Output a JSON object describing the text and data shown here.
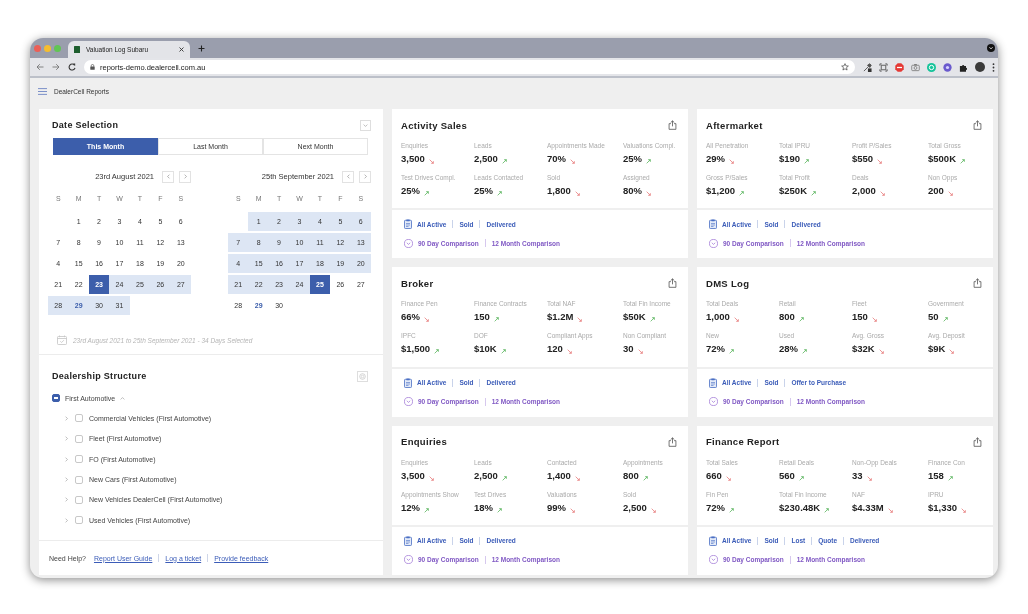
{
  "browser": {
    "tab_title": "Valuation Log Subaru",
    "url": "reports-demo.dealercell.com.au"
  },
  "app_header": {
    "title": "DealerCell Reports"
  },
  "date_selection": {
    "title": "Date Selection",
    "presets": [
      {
        "label": "This Month",
        "selected": true
      },
      {
        "label": "Last Month",
        "selected": false
      },
      {
        "label": "Next Month",
        "selected": false
      }
    ],
    "calendars": [
      {
        "heading": "23rd August 2021",
        "weekdays": [
          "S",
          "M",
          "T",
          "W",
          "T",
          "F",
          "S"
        ],
        "weeks": [
          [
            {
              "day": "1",
              "selected": false,
              "in_range": false,
              "today": false
            },
            {
              "day": "2",
              "selected": false,
              "in_range": false,
              "today": false
            },
            {
              "day": "3",
              "selected": false,
              "in_range": false,
              "today": false
            },
            {
              "day": "4",
              "selected": false,
              "in_range": false,
              "today": false
            },
            {
              "day": "5",
              "selected": false,
              "in_range": false,
              "today": false
            },
            {
              "day": "6",
              "selected": false,
              "in_range": false,
              "today": false
            }
          ],
          [
            {
              "day": "7",
              "selected": false,
              "in_range": false,
              "today": false
            },
            {
              "day": "8",
              "selected": false,
              "in_range": false,
              "today": false
            },
            {
              "day": "9",
              "selected": false,
              "in_range": false,
              "today": false
            },
            {
              "day": "10",
              "selected": false,
              "in_range": false,
              "today": false
            },
            {
              "day": "11",
              "selected": false,
              "in_range": false,
              "today": false
            },
            {
              "day": "12",
              "selected": false,
              "in_range": false,
              "today": false
            },
            {
              "day": "13",
              "selected": false,
              "in_range": false,
              "today": false
            }
          ],
          [
            {
              "day": "4",
              "selected": false,
              "in_range": false,
              "today": false
            },
            {
              "day": "15",
              "selected": false,
              "in_range": false,
              "today": false
            },
            {
              "day": "16",
              "selected": false,
              "in_range": false,
              "today": false
            },
            {
              "day": "17",
              "selected": false,
              "in_range": false,
              "today": false
            },
            {
              "day": "18",
              "selected": false,
              "in_range": false,
              "today": false
            },
            {
              "day": "19",
              "selected": false,
              "in_range": false,
              "today": false
            },
            {
              "day": "20",
              "selected": false,
              "in_range": false,
              "today": false
            }
          ],
          [
            {
              "day": "21",
              "selected": false,
              "in_range": false,
              "today": false
            },
            {
              "day": "22",
              "selected": false,
              "in_range": false,
              "today": false
            },
            {
              "day": "23",
              "selected": true,
              "in_range": true,
              "today": false
            },
            {
              "day": "24",
              "selected": false,
              "in_range": true,
              "today": false
            },
            {
              "day": "25",
              "selected": false,
              "in_range": true,
              "today": false
            },
            {
              "day": "26",
              "selected": false,
              "in_range": true,
              "today": false
            },
            {
              "day": "27",
              "selected": false,
              "in_range": true,
              "today": false
            }
          ],
          [
            {
              "day": "28",
              "selected": false,
              "in_range": true,
              "today": false
            },
            {
              "day": "29",
              "selected": false,
              "in_range": true,
              "today": true
            },
            {
              "day": "30",
              "selected": false,
              "in_range": true,
              "today": false
            },
            {
              "day": "31",
              "selected": false,
              "in_range": true,
              "today": false
            }
          ]
        ]
      },
      {
        "heading": "25th September 2021",
        "weekdays": [
          "S",
          "M",
          "T",
          "W",
          "T",
          "F",
          "S"
        ],
        "weeks": [
          [
            {
              "day": "1",
              "selected": false,
              "in_range": true,
              "today": false
            },
            {
              "day": "2",
              "selected": false,
              "in_range": true,
              "today": false
            },
            {
              "day": "3",
              "selected": false,
              "in_range": true,
              "today": false
            },
            {
              "day": "4",
              "selected": false,
              "in_range": true,
              "today": false
            },
            {
              "day": "5",
              "selected": false,
              "in_range": true,
              "today": false
            },
            {
              "day": "6",
              "selected": false,
              "in_range": true,
              "today": false
            }
          ],
          [
            {
              "day": "7",
              "selected": false,
              "in_range": true,
              "today": false
            },
            {
              "day": "8",
              "selected": false,
              "in_range": true,
              "today": false
            },
            {
              "day": "9",
              "selected": false,
              "in_range": true,
              "today": false
            },
            {
              "day": "10",
              "selected": false,
              "in_range": true,
              "today": false
            },
            {
              "day": "11",
              "selected": false,
              "in_range": true,
              "today": false
            },
            {
              "day": "12",
              "selected": false,
              "in_range": true,
              "today": false
            },
            {
              "day": "13",
              "selected": false,
              "in_range": true,
              "today": false
            }
          ],
          [
            {
              "day": "4",
              "selected": false,
              "in_range": true,
              "today": false
            },
            {
              "day": "15",
              "selected": false,
              "in_range": true,
              "today": false
            },
            {
              "day": "16",
              "selected": false,
              "in_range": true,
              "today": false
            },
            {
              "day": "17",
              "selected": false,
              "in_range": true,
              "today": false
            },
            {
              "day": "18",
              "selected": false,
              "in_range": true,
              "today": false
            },
            {
              "day": "19",
              "selected": false,
              "in_range": true,
              "today": false
            },
            {
              "day": "20",
              "selected": false,
              "in_range": true,
              "today": false
            }
          ],
          [
            {
              "day": "21",
              "selected": false,
              "in_range": true,
              "today": false
            },
            {
              "day": "22",
              "selected": false,
              "in_range": true,
              "today": false
            },
            {
              "day": "23",
              "selected": false,
              "in_range": true,
              "today": false
            },
            {
              "day": "24",
              "selected": false,
              "in_range": true,
              "today": false
            },
            {
              "day": "25",
              "selected": true,
              "in_range": true,
              "today": false
            },
            {
              "day": "26",
              "selected": false,
              "in_range": false,
              "today": false
            },
            {
              "day": "27",
              "selected": false,
              "in_range": false,
              "today": false
            }
          ],
          [
            {
              "day": "28",
              "selected": false,
              "in_range": false,
              "today": false
            },
            {
              "day": "29",
              "selected": false,
              "in_range": false,
              "today": true
            },
            {
              "day": "30",
              "selected": false,
              "in_range": false,
              "today": false
            }
          ]
        ]
      }
    ],
    "range_text": "23rd August 2021 to 25th September 2021 - 34 Days Selected"
  },
  "dealership": {
    "title": "Dealership Structure",
    "tree": [
      {
        "label": "First Automotive",
        "checked": false,
        "indeterminate": true,
        "expanded": true,
        "children": [
          {
            "label": "Commercial Vehicles (First Automotive)",
            "checked": false,
            "indeterminate": false,
            "expanded": false
          },
          {
            "label": "Fleet (First Automotive)",
            "checked": false,
            "indeterminate": false,
            "expanded": false
          },
          {
            "label": "FO (First Automotive)",
            "checked": false,
            "indeterminate": false,
            "expanded": false
          },
          {
            "label": "New Cars (First Automotive)",
            "checked": false,
            "indeterminate": false,
            "expanded": false
          },
          {
            "label": "New Vehicles DealerCell (First Automotive)",
            "checked": false,
            "indeterminate": false,
            "expanded": false
          },
          {
            "label": "Used Vehicles (First Automotive)",
            "checked": false,
            "indeterminate": false,
            "expanded": false
          }
        ]
      }
    ]
  },
  "help": {
    "prompt": "Need Help?",
    "links": [
      "Report User Guide",
      "Log a ticket",
      "Provide feedback"
    ]
  },
  "cards": [
    {
      "title": "Activity Sales",
      "metrics": [
        {
          "label": "Enquiries",
          "value": "3,500",
          "rising": false
        },
        {
          "label": "Leads",
          "value": "2,500",
          "rising": true
        },
        {
          "label": "Appointments Made",
          "value": "70%",
          "rising": false
        },
        {
          "label": "Valuations Compl.",
          "value": "25%",
          "rising": true
        },
        {
          "label": "Test Drives Compl.",
          "value": "25%",
          "rising": true
        },
        {
          "label": "Leads Contacted",
          "value": "25%",
          "rising": true
        },
        {
          "label": "Sold",
          "value": "1,800",
          "rising": false
        },
        {
          "label": "Assigned",
          "value": "80%",
          "rising": false
        }
      ],
      "filters": [
        "All Active",
        "Sold",
        "Delivered"
      ],
      "comparisons": [
        "90 Day Comparison",
        "12 Month Comparison"
      ]
    },
    {
      "title": "Aftermarket",
      "metrics": [
        {
          "label": "All Penetration",
          "value": "29%",
          "rising": false
        },
        {
          "label": "Total IPRU",
          "value": "$190",
          "rising": true
        },
        {
          "label": "Profit P/Sales",
          "value": "$550",
          "rising": false
        },
        {
          "label": "Total Gross",
          "value": "$500K",
          "rising": true
        },
        {
          "label": "Gross P/Sales",
          "value": "$1,200",
          "rising": true
        },
        {
          "label": "Total Profit",
          "value": "$250K",
          "rising": true
        },
        {
          "label": "Deals",
          "value": "2,000",
          "rising": false
        },
        {
          "label": "Non Opps",
          "value": "200",
          "rising": false
        }
      ],
      "filters": [
        "All Active",
        "Sold",
        "Delivered"
      ],
      "comparisons": [
        "90 Day Comparison",
        "12 Month Comparison"
      ]
    },
    {
      "title": "Broker",
      "metrics": [
        {
          "label": "Finance Pen",
          "value": "66%",
          "rising": false
        },
        {
          "label": "Finance Contracts",
          "value": "150",
          "rising": true
        },
        {
          "label": "Total NAF",
          "value": "$1.2M",
          "rising": false
        },
        {
          "label": "Total Fin Income",
          "value": "$50K",
          "rising": true
        },
        {
          "label": "IPFC",
          "value": "$1,500",
          "rising": true
        },
        {
          "label": "DOF",
          "value": "$10K",
          "rising": true
        },
        {
          "label": "Compliant Apps",
          "value": "120",
          "rising": false
        },
        {
          "label": "Non Compliant",
          "value": "30",
          "rising": false
        }
      ],
      "filters": [
        "All Active",
        "Sold",
        "Delivered"
      ],
      "comparisons": [
        "90 Day Comparison",
        "12 Month Comparison"
      ]
    },
    {
      "title": "DMS Log",
      "metrics": [
        {
          "label": "Total Deals",
          "value": "1,000",
          "rising": false
        },
        {
          "label": "Retail",
          "value": "800",
          "rising": true
        },
        {
          "label": "Fleet",
          "value": "150",
          "rising": false
        },
        {
          "label": "Government",
          "value": "50",
          "rising": true
        },
        {
          "label": "New",
          "value": "72%",
          "rising": true
        },
        {
          "label": "Used",
          "value": "28%",
          "rising": true
        },
        {
          "label": "Avg. Gross",
          "value": "$32K",
          "rising": false
        },
        {
          "label": "Avg. Deposit",
          "value": "$9K",
          "rising": false
        }
      ],
      "filters": [
        "All Active",
        "Sold",
        "Offer to Purchase"
      ],
      "comparisons": [
        "90 Day Comparison",
        "12 Month Comparison"
      ]
    },
    {
      "title": "Enquiries",
      "metrics": [
        {
          "label": "Enquiries",
          "value": "3,500",
          "rising": false
        },
        {
          "label": "Leads",
          "value": "2,500",
          "rising": true
        },
        {
          "label": "Contacted",
          "value": "1,400",
          "rising": false
        },
        {
          "label": "Appointments",
          "value": "800",
          "rising": true
        },
        {
          "label": "Appointments Show",
          "value": "12%",
          "rising": true
        },
        {
          "label": "Test Drives",
          "value": "18%",
          "rising": true
        },
        {
          "label": "Valuations",
          "value": "99%",
          "rising": false
        },
        {
          "label": "Sold",
          "value": "2,500",
          "rising": false
        }
      ],
      "filters": [
        "All Active",
        "Sold",
        "Delivered"
      ],
      "comparisons": [
        "90 Day Comparison",
        "12 Month Comparison"
      ]
    },
    {
      "title": "Finance Report",
      "metrics": [
        {
          "label": "Total Sales",
          "value": "660",
          "rising": false
        },
        {
          "label": "Retail Deals",
          "value": "560",
          "rising": true
        },
        {
          "label": "Non-Opp Deals",
          "value": "33",
          "rising": false
        },
        {
          "label": "Finance Con",
          "value": "158",
          "rising": true
        },
        {
          "label": "Fin Pen",
          "value": "72%",
          "rising": true
        },
        {
          "label": "Total Fin Income",
          "value": "$230.48K",
          "rising": true
        },
        {
          "label": "NAF",
          "value": "$4.33M",
          "rising": false
        },
        {
          "label": "IPRU",
          "value": "$1,330",
          "rising": false
        }
      ],
      "filters": [
        "All Active",
        "Sold",
        "Lost",
        "Quote",
        "Delivered"
      ],
      "comparisons": [
        "90 Day Comparison",
        "12 Month Comparison"
      ]
    }
  ]
}
